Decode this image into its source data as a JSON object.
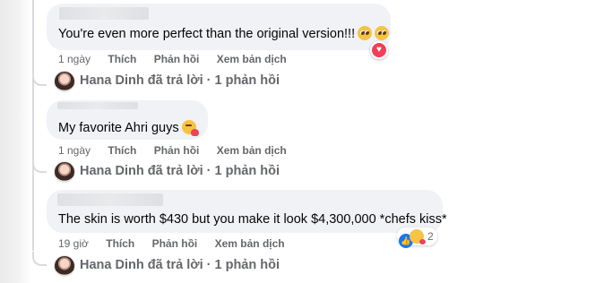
{
  "comments": [
    {
      "text": "You're even more perfect than the original version!!!",
      "emoji": [
        "pleading-face-emoji",
        "pleading-face-emoji"
      ],
      "time": "1 ngày",
      "like_label": "Thích",
      "reply_label": "Phản hồi",
      "translate_label": "Xem bản dịch",
      "reaction": "love-reaction",
      "reply_summary": "Hana Dinh đã trả lời · 1 phản hồi"
    },
    {
      "text": "My favorite Ahri guys",
      "emoji": [
        "face-blowing-kiss-emoji"
      ],
      "time": "1 ngày",
      "like_label": "Thích",
      "reply_label": "Phản hồi",
      "translate_label": "Xem bản dịch",
      "reply_summary": "Hana Dinh đã trả lời · 1 phản hồi"
    },
    {
      "text": "The skin is worth $430 but you make it look $4,300,000 *chefs kiss*",
      "time": "19 giờ",
      "like_label": "Thích",
      "reply_label": "Phản hồi",
      "translate_label": "Xem bản dịch",
      "reaction_count": "2",
      "reply_summary": "Hana Dinh đã trả lời · 1 phản hồi"
    }
  ],
  "colors": {
    "bubble": "#f0f2f5",
    "meta_text": "#65676b",
    "love": "#f33e58",
    "like": "#1877f2"
  }
}
